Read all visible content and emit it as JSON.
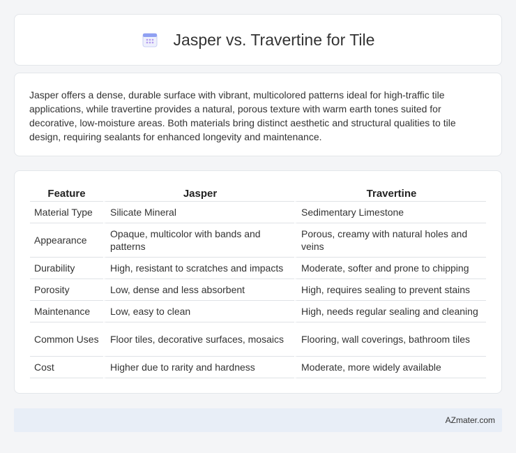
{
  "header": {
    "title": "Jasper vs. Travertine for Tile",
    "icon": "calendar-icon"
  },
  "intro": {
    "text": "Jasper offers a dense, durable surface with vibrant, multicolored patterns ideal for high-traffic tile applications, while travertine provides a natural, porous texture with warm earth tones suited for decorative, low-moisture areas. Both materials bring distinct aesthetic and structural qualities to tile design, requiring sealants for enhanced longevity and maintenance."
  },
  "table": {
    "headers": [
      "Feature",
      "Jasper",
      "Travertine"
    ],
    "rows": [
      [
        "Material Type",
        "Silicate Mineral",
        "Sedimentary Limestone"
      ],
      [
        "Appearance",
        "Opaque, multicolor with bands and patterns",
        "Porous, creamy with natural holes and veins"
      ],
      [
        "Durability",
        "High, resistant to scratches and impacts",
        "Moderate, softer and prone to chipping"
      ],
      [
        "Porosity",
        "Low, dense and less absorbent",
        "High, requires sealing to prevent stains"
      ],
      [
        "Maintenance",
        "Low, easy to clean",
        "High, needs regular sealing and cleaning"
      ],
      [
        "Common Uses",
        "Floor tiles, decorative surfaces, mosaics",
        "Flooring, wall coverings, bathroom tiles"
      ],
      [
        "Cost",
        "Higher due to rarity and hardness",
        "Moderate, more widely available"
      ]
    ]
  },
  "footer": {
    "brand": "AZmater.com"
  },
  "colors": {
    "icon_accent": "#7b8ff0",
    "footer_bg": "#e8eef7"
  }
}
